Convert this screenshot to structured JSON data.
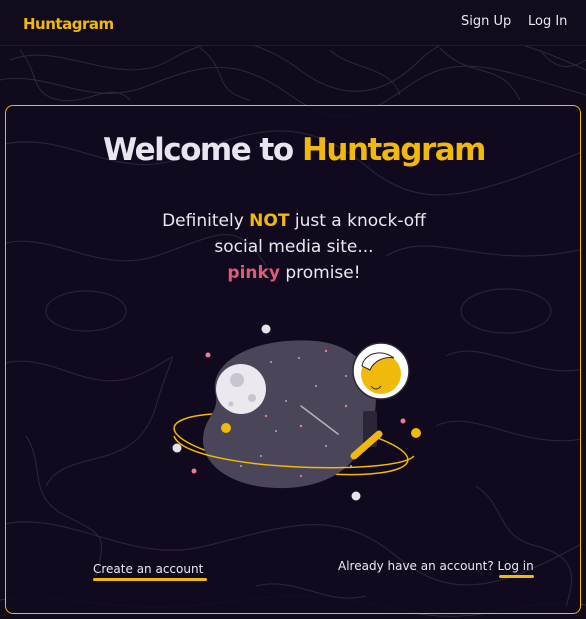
{
  "nav": {
    "logo": "Huntagram",
    "signup": "Sign Up",
    "login": "Log In"
  },
  "hero": {
    "welcome_prefix": "Welcome to ",
    "welcome_brand": "Huntagram",
    "line1_pre": "Definitely ",
    "line1_highlight": "NOT",
    "line1_post": " just a knock-off",
    "line2": "social media site...",
    "line3_highlight": "pinky",
    "line3_post": " promise!"
  },
  "footer": {
    "create_account": "Create an account",
    "already_text": "Already have an account? ",
    "login_link": "Log in"
  },
  "colors": {
    "accent": "#f0b90b",
    "pink": "#e05a7a",
    "background": "#110a1d"
  },
  "icons": {
    "illustration": "astronaut-planet-illustration"
  }
}
